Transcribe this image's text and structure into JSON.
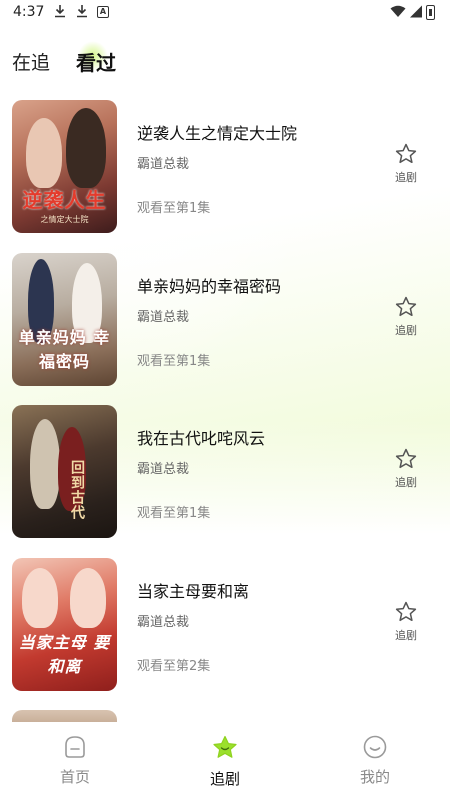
{
  "status_bar": {
    "time": "4:37",
    "icons": [
      "download-icon",
      "download-icon",
      "a-badge-icon",
      "wifi-icon",
      "signal-icon",
      "battery-icon"
    ]
  },
  "tabs": [
    {
      "label": "在追",
      "active": false
    },
    {
      "label": "看过",
      "active": true
    }
  ],
  "dramas": [
    {
      "title": "逆袭人生之情定大士院",
      "genre": "霸道总裁",
      "progress": "观看至第1集",
      "follow_label": "追剧",
      "cover_text": "逆袭人生",
      "cover_sub": "之情定大士院"
    },
    {
      "title": "单亲妈妈的幸福密码",
      "genre": "霸道总裁",
      "progress": "观看至第1集",
      "follow_label": "追剧",
      "cover_text": "单亲妈妈 幸福密码"
    },
    {
      "title": "我在古代叱咤风云",
      "genre": "霸道总裁",
      "progress": "观看至第1集",
      "follow_label": "追剧",
      "cover_text": "回到古代"
    },
    {
      "title": "当家主母要和离",
      "genre": "霸道总裁",
      "progress": "观看至第2集",
      "follow_label": "追剧",
      "cover_text": "当家主母 要和离"
    }
  ],
  "bottom_nav": [
    {
      "label": "首页",
      "icon": "home-icon",
      "active": false
    },
    {
      "label": "追剧",
      "icon": "star-icon",
      "active": true
    },
    {
      "label": "我的",
      "icon": "smiley-icon",
      "active": false
    }
  ],
  "colors": {
    "accent_green": "#9be02c",
    "background_tint": "#ecf9cc",
    "text_primary": "#111111",
    "text_secondary": "#888888"
  }
}
